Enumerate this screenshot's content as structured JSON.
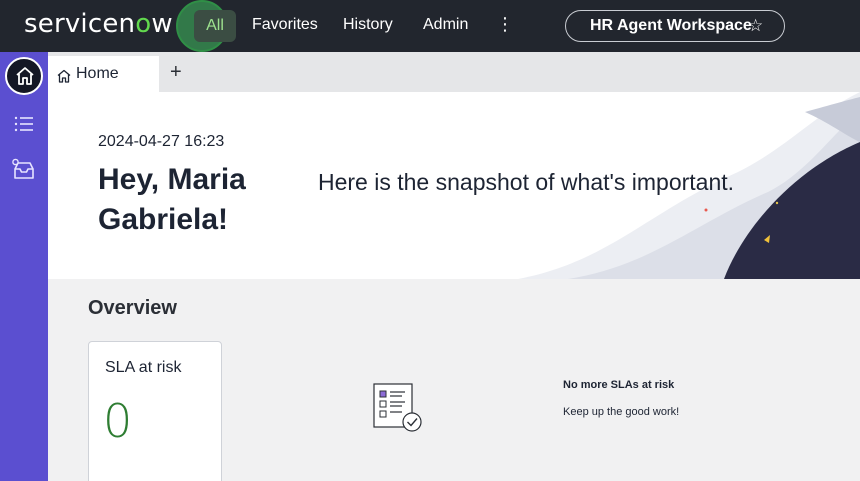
{
  "nav": {
    "brand_left": "servicen",
    "brand_o": "o",
    "brand_right": "w",
    "all_label": "All",
    "favorites_label": "Favorites",
    "history_label": "History",
    "admin_label": "Admin",
    "more_label": "⋮",
    "workspace_label": "HR Agent Workspace",
    "star_glyph": "☆"
  },
  "tabs": {
    "home_label": "Home",
    "add_glyph": "+"
  },
  "banner": {
    "datetime": "2024-04-27 16:23",
    "greeting_line1": "Hey, Maria",
    "greeting_line2": "Gabriela!",
    "tagline": "Here is the snapshot of what's important."
  },
  "overview": {
    "title": "Overview",
    "card_label": "SLA at risk",
    "card_value": "0",
    "empty_title": "No more SLAs at risk",
    "empty_subtitle": "Keep up the good work!"
  },
  "colors": {
    "nav_bg": "#22262e",
    "rail_bg": "#5b4fd0",
    "brand_green": "#62d84e",
    "value_green": "#2e7d32"
  },
  "icons": {
    "rail": [
      "home-icon",
      "list-icon",
      "inbox-icon"
    ],
    "tab": "home-icon",
    "workspace": "star-icon"
  }
}
